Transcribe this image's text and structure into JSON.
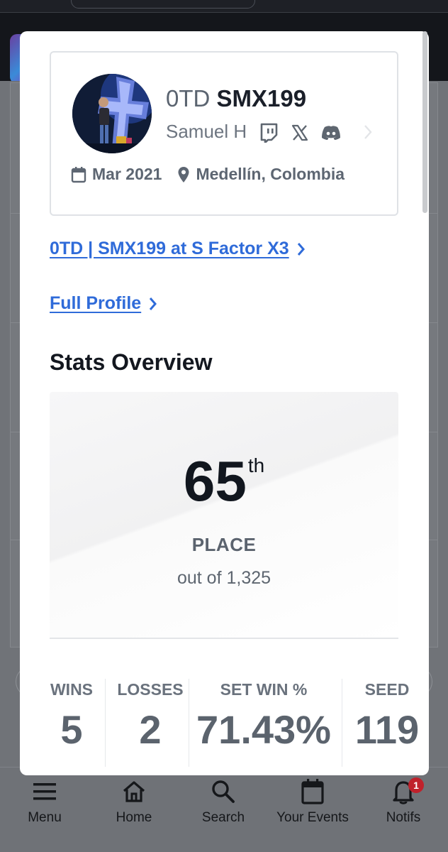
{
  "nav": [
    {
      "label": "Menu",
      "icon": "menu-icon"
    },
    {
      "label": "Home",
      "icon": "home-icon"
    },
    {
      "label": "Search",
      "icon": "search-icon"
    },
    {
      "label": "Your Events",
      "icon": "calendar-icon"
    },
    {
      "label": "Notifs",
      "icon": "bell-icon",
      "badge": "1"
    }
  ],
  "profile": {
    "prefix": "0TD",
    "gamertag": "SMX199",
    "real_name": "Samuel H",
    "socials": [
      "twitch-icon",
      "x-icon",
      "discord-icon"
    ],
    "joined": "Mar 2021",
    "location": "Medellín, Colombia"
  },
  "links": {
    "event": "0TD | SMX199 at S Factor X3",
    "full_profile": "Full Profile"
  },
  "stats": {
    "title": "Stats Overview",
    "place": "65",
    "place_suffix": "th",
    "place_label": "PLACE",
    "out_of": "out of 1,325",
    "columns": [
      {
        "label": "WINS",
        "value": "5"
      },
      {
        "label": "LOSSES",
        "value": "2"
      },
      {
        "label": "SET WIN %",
        "value": "71.43%"
      },
      {
        "label": "SEED",
        "value": "119"
      }
    ]
  },
  "colors": {
    "link": "#2f6bd9",
    "badge": "#c0212b"
  }
}
